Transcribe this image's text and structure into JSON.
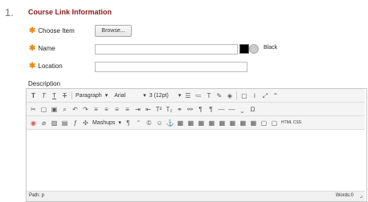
{
  "section": {
    "step": "1.",
    "title": "Course Link Information"
  },
  "form": {
    "choose_item_label": "Choose Item",
    "browse_label": "Browse...",
    "name_label": "Name",
    "name_value": "",
    "color_name": "Black",
    "location_label": "Location",
    "location_value": "",
    "description_label": "Description",
    "required_mark": "✱"
  },
  "editor": {
    "format_labels": [
      "T",
      "T",
      "T",
      "T"
    ],
    "paragraph": "Paragraph",
    "font": "Arial",
    "size": "3 (12pt)",
    "mashups": "Mashups",
    "html_css": "HTML CSS",
    "path_label": "Path: p",
    "words_label": "Words:0"
  },
  "colors": {
    "title": "#8a1a1a",
    "required": "#e8891a",
    "swatch": "#000000"
  }
}
